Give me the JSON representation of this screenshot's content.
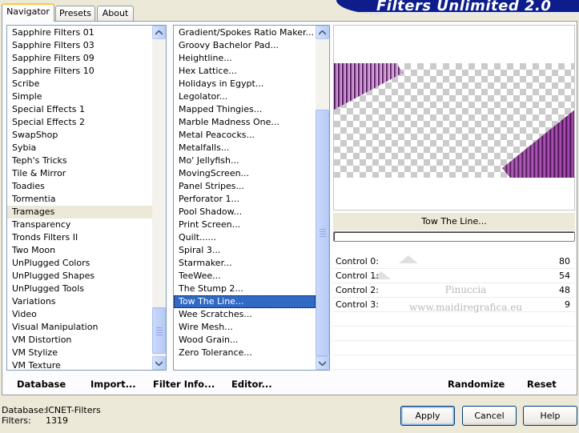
{
  "tabs": [
    {
      "label": "Navigator"
    },
    {
      "label": "Presets"
    },
    {
      "label": "About"
    }
  ],
  "banner_title": "Filters Unlimited 2.0",
  "categories": {
    "items": [
      "Sapphire Filters 01",
      "Sapphire Filters 03",
      "Sapphire Filters 09",
      "Sapphire Filters 10",
      "Scribe",
      "Simple",
      "Special Effects 1",
      "Special Effects 2",
      "SwapShop",
      "Sybia",
      "Teph's Tricks",
      "Tile & Mirror",
      "Toadies",
      "Tormentia",
      "Tramages",
      "Transparency",
      "Tronds Filters II",
      "Two Moon",
      "UnPlugged Colors",
      "UnPlugged Shapes",
      "UnPlugged Tools",
      "Variations",
      "Video",
      "Visual Manipulation",
      "VM Distortion",
      "VM Stylize",
      "VM Texture"
    ],
    "selected": "Tramages"
  },
  "filters": {
    "items": [
      "Gradient/Spokes Ratio Maker...",
      "Groovy Bachelor Pad...",
      "Heightline...",
      "Hex Lattice...",
      "Holidays in Egypt...",
      "Legolator...",
      "Mapped Thingies...",
      "Marble Madness One...",
      "Metal Peacocks...",
      "Metalfalls...",
      "Mo' Jellyfish...",
      "MovingScreen...",
      "Panel Stripes...",
      "Perforator 1...",
      "Pool Shadow...",
      "Print Screen...",
      "Quilt......",
      "Spiral 3...",
      "Starmaker...",
      "TeeWee...",
      "The Stump 2...",
      "Tow The Line...",
      "Wee Scratches...",
      "Wire Mesh...",
      "Wood Grain...",
      "Zero Tolerance..."
    ],
    "selected": "Tow The Line..."
  },
  "toolbar": {
    "database": "Database",
    "import": "Import...",
    "filter_info": "Filter Info...",
    "editor": "Editor...",
    "randomize": "Randomize",
    "reset": "Reset"
  },
  "selected_filter_name": "Tow The Line...",
  "controls": [
    {
      "label": "Control 0:",
      "value": "80"
    },
    {
      "label": "Control 1:",
      "value": "54"
    },
    {
      "label": "Control 2:",
      "value": "48"
    },
    {
      "label": "Control 3:",
      "value": "9"
    }
  ],
  "watermark": {
    "line1": "Pinuccia",
    "line2": "www.maidiregrafica.eu"
  },
  "status": {
    "database_label": "Database:",
    "database_value": "ICNET-Filters",
    "filters_label": "Filters:",
    "filters_value": "1319"
  },
  "buttons": {
    "apply": "Apply",
    "cancel": "Cancel",
    "help": "Help"
  },
  "colors": {
    "accent": "#316ac5",
    "banner": "#0d1e8c",
    "purple": "#8a2d8f"
  }
}
